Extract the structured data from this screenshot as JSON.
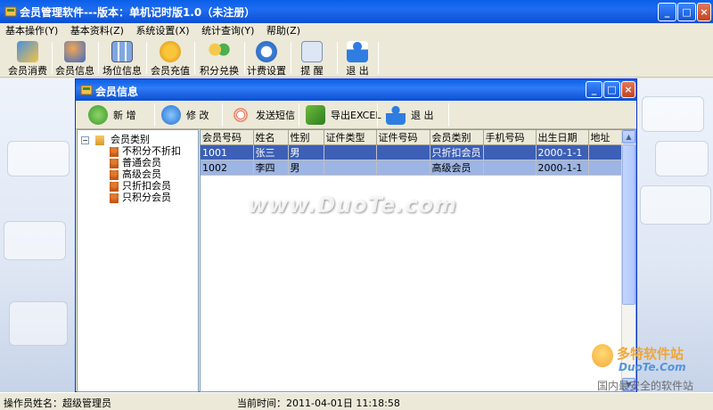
{
  "app": {
    "title": "会员管理软件---版本：单机记时版1.0（未注册）",
    "controls": {
      "minimize": "_",
      "maximize": "□",
      "close": "×"
    }
  },
  "menu": [
    "基本操作(Y)",
    "基本资料(Z)",
    "系统设置(X)",
    "统计查询(Y)",
    "帮助(Z)"
  ],
  "toolbar": [
    {
      "label": "会员消费",
      "icon": "member-consume-icon"
    },
    {
      "label": "会员信息",
      "icon": "member-info-icon"
    },
    {
      "label": "场位信息",
      "icon": "venue-info-icon"
    },
    {
      "label": "会员充值",
      "icon": "recharge-icon"
    },
    {
      "label": "积分兑换",
      "icon": "points-exchange-icon"
    },
    {
      "label": "计费设置",
      "icon": "billing-settings-icon"
    },
    {
      "label": "提 醒",
      "icon": "reminder-icon"
    },
    {
      "label": "退 出",
      "icon": "exit-icon"
    }
  ],
  "child": {
    "title": "会员信息",
    "buttons": [
      {
        "label": "新 增",
        "icon": "add-icon"
      },
      {
        "label": "修 改",
        "icon": "edit-icon"
      },
      {
        "label": "发送短信",
        "icon": "sms-icon"
      },
      {
        "label": "导出EXCEL",
        "icon": "export-excel-icon"
      },
      {
        "label": "退 出",
        "icon": "exit-icon"
      }
    ],
    "tree": {
      "root": "会员类别",
      "items": [
        "不积分不折扣",
        "普通会员",
        "高级会员",
        "只折扣会员",
        "只积分会员"
      ]
    },
    "grid": {
      "columns": [
        "会员号码",
        "姓名",
        "性别",
        "证件类型",
        "证件号码",
        "会员类别",
        "手机号码",
        "出生日期",
        "地址"
      ],
      "rows": [
        [
          "1001",
          "张三",
          "男",
          "",
          "",
          "只折扣会员",
          "",
          "2000-1-1",
          ""
        ],
        [
          "1002",
          "李四",
          "男",
          "",
          "",
          "高级会员",
          "",
          "2000-1-1",
          ""
        ]
      ]
    }
  },
  "status": {
    "operator": "操作员姓名：超级管理员",
    "time": "当前时间：2011-04-01日 11:18:58"
  },
  "watermark": "www.DuoTe.com",
  "logo": {
    "text": "多特软件站",
    "sub": "DuoTe.Com",
    "slogan": "国内最安全的软件站"
  },
  "colors": {
    "title_bar": "#0a5fe8",
    "selected_row": "#3d5fb5",
    "second_row": "#9db5e4"
  }
}
